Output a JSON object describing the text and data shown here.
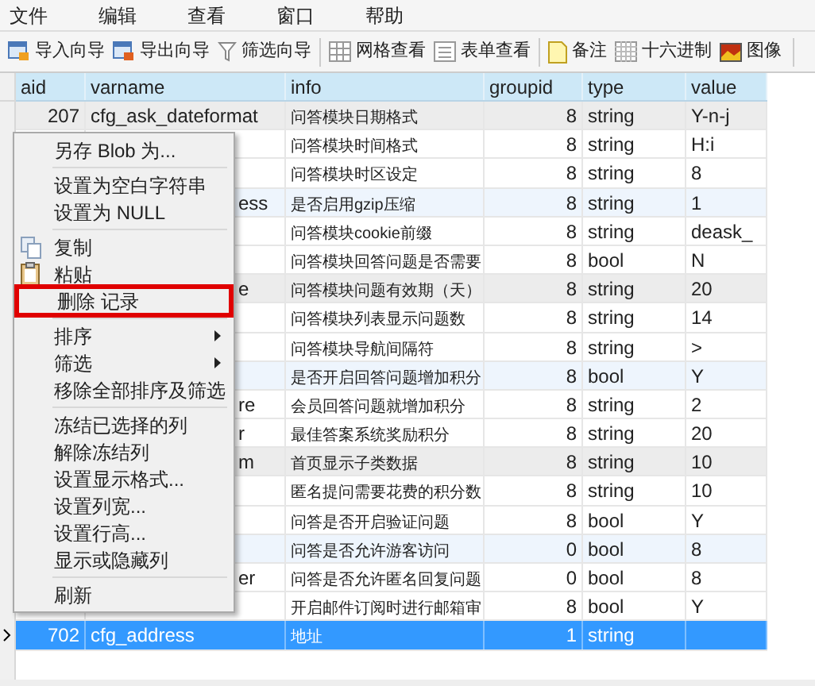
{
  "menu_bar": [
    "文件",
    "编辑",
    "查看",
    "窗口",
    "帮助"
  ],
  "toolbar": [
    [
      "导入向导",
      "导出向导",
      "筛选向导"
    ],
    [
      "网格查看",
      "表单查看"
    ],
    [
      "备注",
      "十六进制",
      "图像"
    ]
  ],
  "table": {
    "columns": [
      "aid",
      "varname",
      "info",
      "groupid",
      "type",
      "value"
    ],
    "rows": [
      {
        "aid": "207",
        "varname": "cfg_ask_dateformat",
        "info": "问答模块日期格式",
        "groupid": "8",
        "type": "string",
        "value": "Y-n-j",
        "selected": false
      },
      {
        "info": "问答模块时间格式",
        "groupid": "8",
        "type": "string",
        "value": "H:i",
        "selected": false
      },
      {
        "info": "问答模块时区设定",
        "groupid": "8",
        "type": "string",
        "value": "8",
        "selected": false
      },
      {
        "varname": "ess",
        "info": "是否启用gzip压缩",
        "groupid": "8",
        "type": "string",
        "value": "1",
        "selected": false
      },
      {
        "info": "问答模块cookie前缀",
        "groupid": "8",
        "type": "string",
        "value": "deask_",
        "selected": false
      },
      {
        "info": "问答模块回答问题是否需要",
        "groupid": "8",
        "type": "bool",
        "value": "N",
        "selected": false
      },
      {
        "varname": "e",
        "info": "问答模块问题有效期（天）",
        "groupid": "8",
        "type": "string",
        "value": "20",
        "selected": false
      },
      {
        "info": "问答模块列表显示问题数",
        "groupid": "8",
        "type": "string",
        "value": "14",
        "selected": false
      },
      {
        "info": "问答模块导航间隔符",
        "groupid": "8",
        "type": "string",
        "value": ">",
        "selected": false
      },
      {
        "info": "是否开启回答问题增加积分",
        "groupid": "8",
        "type": "bool",
        "value": "Y",
        "selected": false
      },
      {
        "varname": "re",
        "info": "会员回答问题就增加积分",
        "groupid": "8",
        "type": "string",
        "value": "2",
        "selected": false
      },
      {
        "varname": "r",
        "info": "最佳答案系统奖励积分",
        "groupid": "8",
        "type": "string",
        "value": "20",
        "selected": false
      },
      {
        "varname": "m",
        "info": "首页显示子类数据",
        "groupid": "8",
        "type": "string",
        "value": "10",
        "selected": false
      },
      {
        "info": "匿名提问需要花费的积分数",
        "groupid": "8",
        "type": "string",
        "value": "10",
        "selected": false
      },
      {
        "info": "问答是否开启验证问题",
        "groupid": "8",
        "type": "bool",
        "value": "Y",
        "selected": false
      },
      {
        "info": "问答是否允许游客访问",
        "groupid": "0",
        "type": "bool",
        "value": "8",
        "selected": false
      },
      {
        "varname": "er",
        "info": "问答是否允许匿名回复问题",
        "groupid": "0",
        "type": "bool",
        "value": "8",
        "selected": false
      },
      {
        "info": "开启邮件订阅时进行邮箱审",
        "groupid": "8",
        "type": "bool",
        "value": "Y",
        "selected": false
      },
      {
        "aid": "702",
        "varname": "cfg_address",
        "info": "地址",
        "groupid": "1",
        "type": "string",
        "selected": true
      }
    ]
  },
  "context_menu": [
    {
      "kind": "item",
      "label": "另存 Blob 为..."
    },
    {
      "kind": "separator"
    },
    {
      "kind": "item",
      "label": "设置为空白字符串"
    },
    {
      "kind": "item",
      "label": "设置为 NULL"
    },
    {
      "kind": "separator"
    },
    {
      "kind": "icon_item",
      "label": "复制"
    },
    {
      "kind": "icon_item",
      "label": "粘贴"
    },
    {
      "kind": "item",
      "label": "删除 记录",
      "marked": true
    },
    {
      "kind": "separator"
    },
    {
      "kind": "submenu",
      "label": "排序"
    },
    {
      "kind": "submenu",
      "label": "筛选"
    },
    {
      "kind": "item",
      "label": "移除全部排序及筛选"
    },
    {
      "kind": "separator"
    },
    {
      "kind": "item",
      "label": "冻结已选择的列"
    },
    {
      "kind": "item",
      "label": "解除冻结列"
    },
    {
      "kind": "item",
      "label": "设置显示格式..."
    },
    {
      "kind": "item",
      "label": "设置列宽..."
    },
    {
      "kind": "item",
      "label": "设置行高..."
    },
    {
      "kind": "item",
      "label": "显示或隐藏列"
    },
    {
      "kind": "separator"
    },
    {
      "kind": "item",
      "label": "刷新"
    }
  ]
}
